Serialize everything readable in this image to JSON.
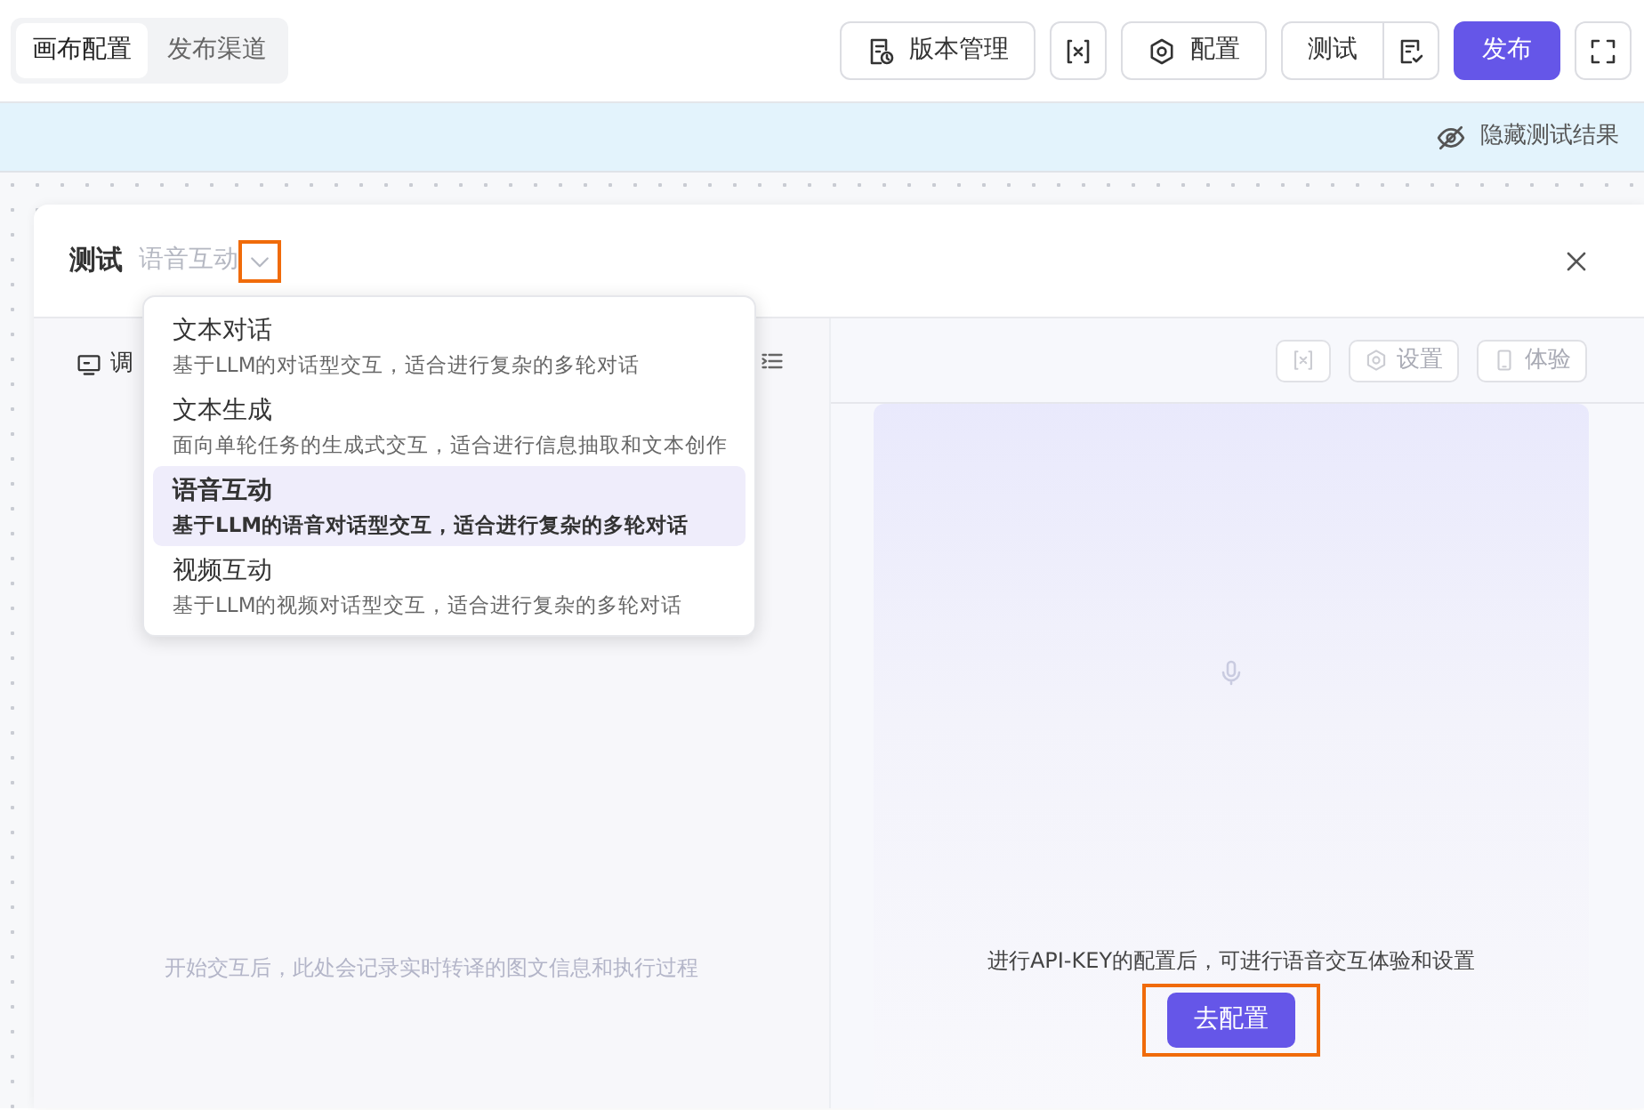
{
  "top_tabs": [
    {
      "label": "画布配置",
      "selected": true
    },
    {
      "label": "发布渠道",
      "selected": false
    }
  ],
  "toolbar": {
    "version_label": "版本管理",
    "config_label": "配置",
    "test_label": "测试",
    "publish_label": "发布"
  },
  "banner": {
    "label": "隐藏测试结果"
  },
  "panel": {
    "title": "测试",
    "mode": "语音互动",
    "mode_highlighted": true,
    "menu_open": true,
    "left_tab": "调",
    "empty_hint": "开始交互后，此处会记录实时转译的图文信息和执行过程",
    "settings_label": "设置",
    "try_label": "体验",
    "tools_disabled": true
  },
  "menu": [
    {
      "title": "文本对话",
      "description": "基于LLM的对话型交互，适合进行复杂的多轮对话",
      "selected": false
    },
    {
      "title": "文本生成",
      "description": "面向单轮任务的生成式交互，适合进行信息抽取和文本创作",
      "selected": false
    },
    {
      "title": "语音互动",
      "description": "基于LLM的语音对话型交互，适合进行复杂的多轮对话",
      "selected": true
    },
    {
      "title": "视频互动",
      "description": "基于LLM的视频对话型交互，适合进行复杂的多轮对话",
      "selected": false
    }
  ],
  "preview": {
    "message": "进行API-KEY的配置后，可进行语音交互体验和设置",
    "button": "去配置",
    "button_highlighted": true
  }
}
